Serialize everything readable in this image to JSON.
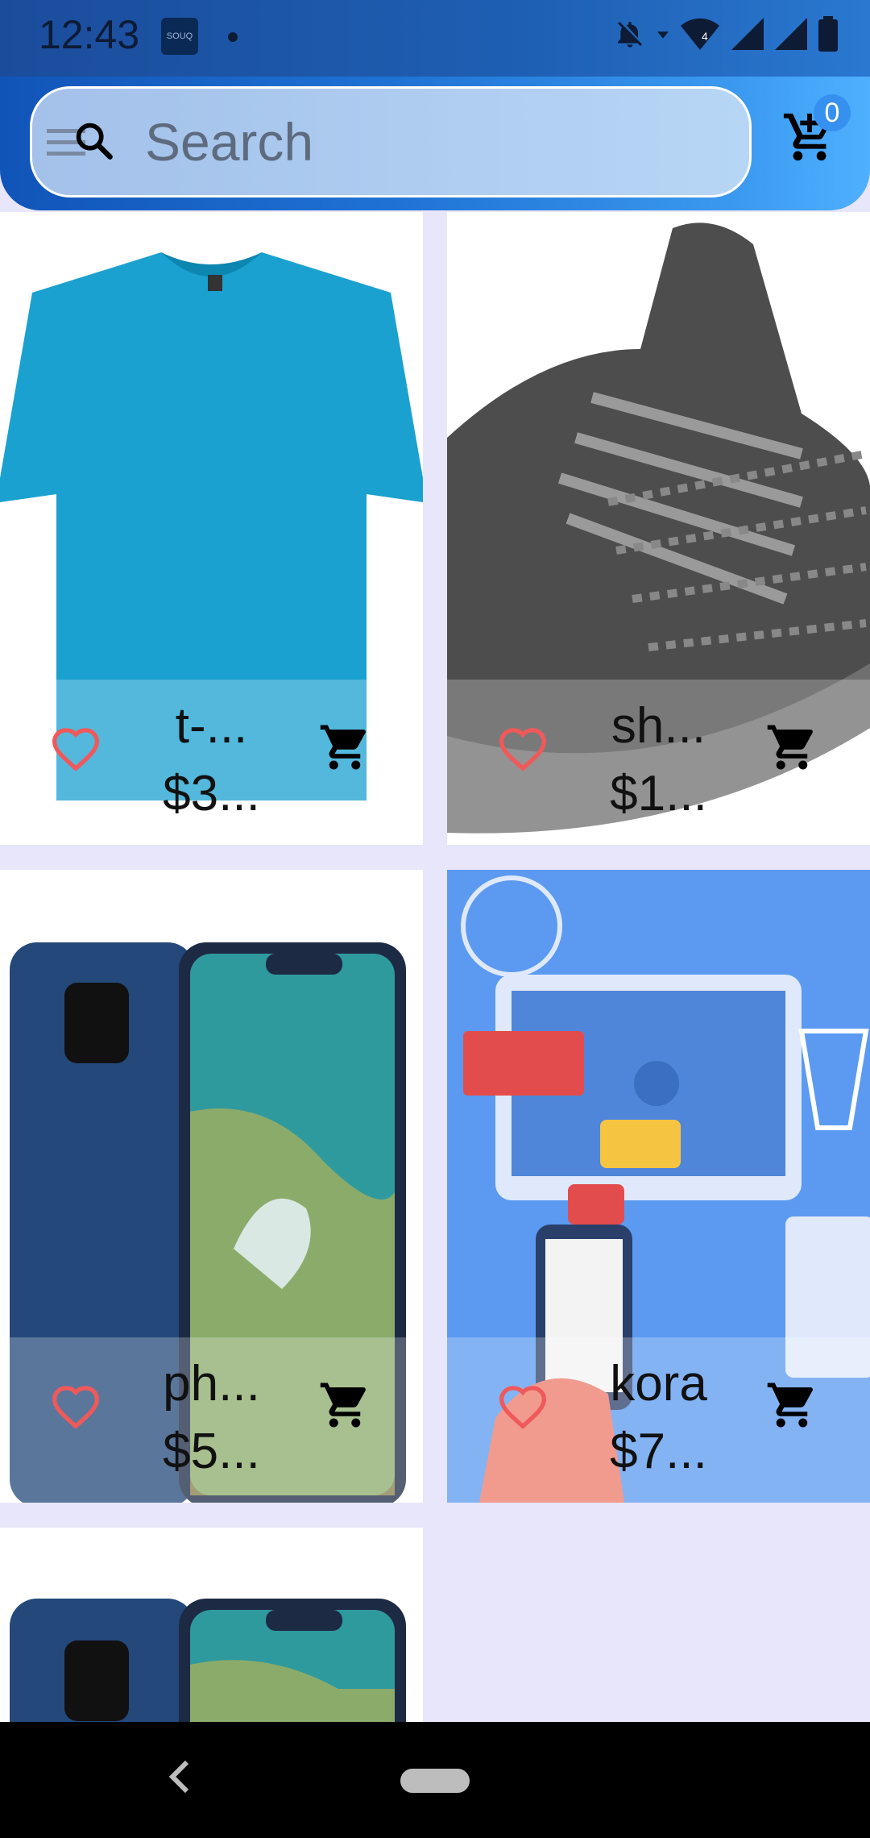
{
  "status_bar": {
    "time": "12:43",
    "app_icon": "souq-icon",
    "app_icon_text": "SOUQ",
    "signal_labels": [
      "4"
    ]
  },
  "app_bar": {
    "search_placeholder": "Search",
    "cart_count": "0"
  },
  "products": [
    {
      "name": "t-...",
      "price": "$3...",
      "image": "blue-tshirt"
    },
    {
      "name": "sh...",
      "price": "$1...",
      "image": "grey-sneaker"
    },
    {
      "name": "ph...",
      "price": "$5...",
      "image": "blue-smartphone"
    },
    {
      "name": "kora",
      "price": "$7...",
      "image": "online-shopping-illustration"
    },
    {
      "name": "",
      "price": "",
      "image": "blue-smartphone"
    }
  ],
  "colors": {
    "accent": "#1f72d4",
    "favorite": "#f0595a",
    "background": "#e8e6fb"
  }
}
